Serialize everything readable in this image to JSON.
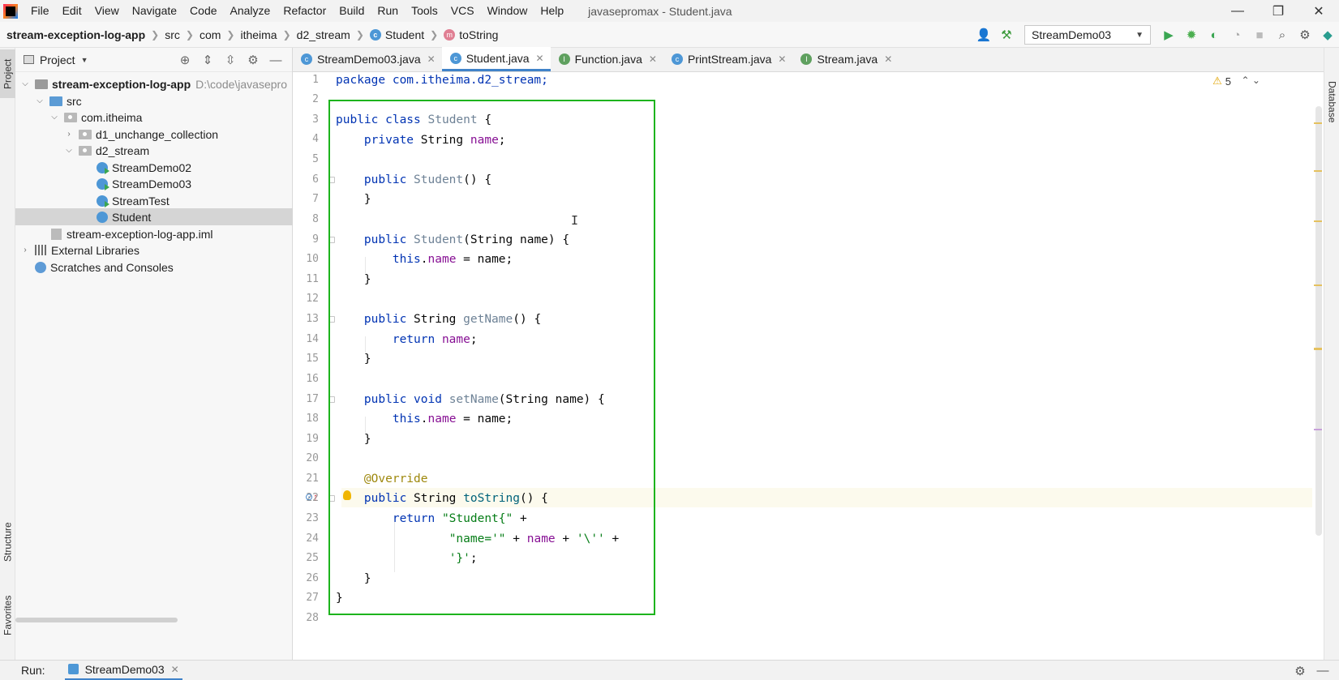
{
  "window": {
    "title": "javasepromax - Student.java",
    "minimize": "—",
    "restore": "❐",
    "close": "✕"
  },
  "menu": [
    "File",
    "Edit",
    "View",
    "Navigate",
    "Code",
    "Analyze",
    "Refactor",
    "Build",
    "Run",
    "Tools",
    "VCS",
    "Window",
    "Help"
  ],
  "breadcrumb": {
    "project": "stream-exception-log-app",
    "items": [
      "src",
      "com",
      "itheima",
      "d2_stream"
    ],
    "class": "Student",
    "method": "toString"
  },
  "run_config": {
    "name": "StreamDemo03"
  },
  "left_strip": {
    "project": "Project",
    "structure": "Structure",
    "favorites": "Favorites"
  },
  "right_strip": {
    "database": "Database"
  },
  "project_panel": {
    "title": "Project",
    "tree": {
      "root": "stream-exception-log-app",
      "root_path": "D:\\code\\javasepro",
      "src": "src",
      "pkg": "com.itheima",
      "d1": "d1_unchange_collection",
      "d2": "d2_stream",
      "c1": "StreamDemo02",
      "c2": "StreamDemo03",
      "c3": "StreamTest",
      "c4": "Student",
      "iml": "stream-exception-log-app.iml",
      "libs": "External Libraries",
      "scratches": "Scratches and Consoles"
    }
  },
  "tabs": [
    {
      "label": "StreamDemo03.java"
    },
    {
      "label": "Student.java"
    },
    {
      "label": "Function.java"
    },
    {
      "label": "PrintStream.java"
    },
    {
      "label": "Stream.java"
    }
  ],
  "editor": {
    "warnings_count": "5",
    "line_numbers": [
      "1",
      "2",
      "3",
      "4",
      "5",
      "6",
      "7",
      "8",
      "9",
      "10",
      "11",
      "12",
      "13",
      "14",
      "15",
      "16",
      "17",
      "18",
      "19",
      "20",
      "21",
      "22",
      "23",
      "24",
      "25",
      "26",
      "27",
      "28"
    ],
    "code": {
      "l1": "package com.itheima.d2_stream;",
      "l3_kw": "public class ",
      "l3_name": "Student",
      "l3_end": " {",
      "l4_kw": "    private ",
      "l4_type": "String ",
      "l4_field": "name",
      "l4_end": ";",
      "l6_kw": "    public ",
      "l6_name": "Student",
      "l6_end": "() {",
      "l7": "    }",
      "l9_kw": "    public ",
      "l9_name": "Student",
      "l9_end": "(String name) {",
      "l10_kw": "        this",
      "l10_dot": ".",
      "l10_field": "name",
      "l10_end": " = name;",
      "l11": "    }",
      "l13_kw": "    public ",
      "l13_type": "String ",
      "l13_name": "getName",
      "l13_end": "() {",
      "l14_kw": "        return ",
      "l14_field": "name",
      "l14_end": ";",
      "l15": "    }",
      "l17_kw": "    public void ",
      "l17_name": "setName",
      "l17_end": "(String name) {",
      "l18_kw": "        this",
      "l18_dot": ".",
      "l18_field": "name",
      "l18_end": " = name;",
      "l19": "    }",
      "l21": "    @Override",
      "l22_kw": "    public ",
      "l22_type": "String ",
      "l22_name": "toString",
      "l22_end": "() {",
      "l23_kw": "        return ",
      "l23_str": "\"Student{\"",
      "l23_end": " +",
      "l24_pad": "                ",
      "l24_str": "\"name='\"",
      "l24_mid": " + ",
      "l24_field": "name",
      "l24_mid2": " + ",
      "l24_str2": "'\\''",
      "l24_end": " +",
      "l25_pad": "                ",
      "l25_str": "'}'",
      "l25_end": ";",
      "l26": "    }",
      "l27": "}"
    }
  },
  "bottom": {
    "run_label": "Run:",
    "run_tab": "StreamDemo03"
  }
}
